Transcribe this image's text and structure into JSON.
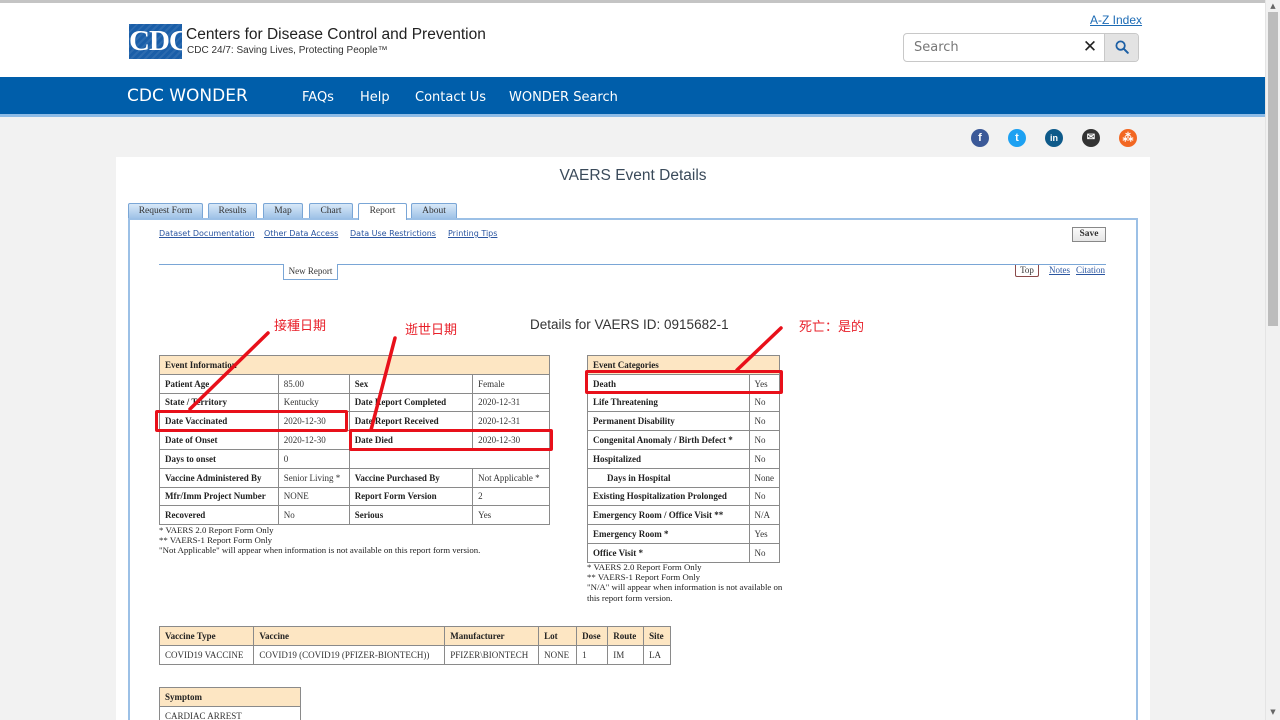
{
  "header": {
    "logo_text": "CDC",
    "org_name": "Centers for Disease Control and Prevention",
    "tagline": "CDC 24/7: Saving Lives, Protecting People™",
    "az_index": "A-Z Index",
    "search_placeholder": "Search",
    "search_value": "",
    "clear_glyph": "✕"
  },
  "nav": {
    "brand": "CDC WONDER",
    "items": [
      "FAQs",
      "Help",
      "Contact Us",
      "WONDER Search"
    ]
  },
  "social": [
    {
      "icon": "facebook-icon",
      "glyph": "f",
      "color": "#3b5998"
    },
    {
      "icon": "twitter-icon",
      "glyph": "t",
      "color": "#1da1f2"
    },
    {
      "icon": "linkedin-icon",
      "glyph": "in",
      "color": "#0e5a8a"
    },
    {
      "icon": "email-icon",
      "glyph": "✉",
      "color": "#333333"
    },
    {
      "icon": "syndicate-icon",
      "glyph": "⁂",
      "color": "#f26722"
    }
  ],
  "page": {
    "title": "VAERS Event Details",
    "tabs": [
      "Request Form",
      "Results",
      "Map",
      "Chart",
      "Report",
      "About"
    ],
    "active_tab": "Report",
    "links": [
      "Dataset Documentation",
      "Other Data Access",
      "Data Use Restrictions",
      "Printing Tips"
    ],
    "save_label": "Save",
    "new_report_label": "New Report",
    "top_label": "Top",
    "notes_label": "Notes",
    "citation_label": "Citation",
    "details_title": "Details for VAERS ID: 0915682-1"
  },
  "annotations": {
    "date_vaccinated": "接種日期",
    "date_died": "逝世日期",
    "death_yes": "死亡：是的",
    "highlight_color": "#e8101a"
  },
  "event_information": {
    "header": "Event Information",
    "rows": [
      [
        {
          "label": "Patient Age",
          "value": "85.00"
        },
        {
          "label": "Sex",
          "value": "Female"
        }
      ],
      [
        {
          "label": "State / Territory",
          "value": "Kentucky"
        },
        {
          "label": "Date Report Completed",
          "value": "2020-12-31"
        }
      ],
      [
        {
          "label": "Date Vaccinated",
          "value": "2020-12-30"
        },
        {
          "label": "Date Report Received",
          "value": "2020-12-31"
        }
      ],
      [
        {
          "label": "Date of Onset",
          "value": "2020-12-30"
        },
        {
          "label": "Date Died",
          "value": "2020-12-30"
        }
      ],
      [
        {
          "label": "Days to onset",
          "value": "0"
        },
        {
          "label": "",
          "value": ""
        }
      ],
      [
        {
          "label": "Vaccine Administered By",
          "value": "Senior Living *"
        },
        {
          "label": "Vaccine Purchased By",
          "value": "Not Applicable *"
        }
      ],
      [
        {
          "label": "Mfr/Imm Project Number",
          "value": "NONE"
        },
        {
          "label": "Report Form Version",
          "value": "2"
        }
      ],
      [
        {
          "label": "Recovered",
          "value": "No"
        },
        {
          "label": "Serious",
          "value": "Yes"
        }
      ]
    ],
    "notes": [
      "* VAERS 2.0 Report Form Only",
      "** VAERS-1 Report Form Only",
      "\"Not Applicable\" will appear when information is not available on this report form version."
    ]
  },
  "event_categories": {
    "header": "Event Categories",
    "rows": [
      {
        "label": "Death",
        "value": "Yes"
      },
      {
        "label": "Life Threatening",
        "value": "No"
      },
      {
        "label": "Permanent Disability",
        "value": "No"
      },
      {
        "label": "Congenital Anomaly / Birth Defect *",
        "value": "No"
      },
      {
        "label": "Hospitalized",
        "value": "No"
      },
      {
        "label": "Days in Hospital",
        "value": "None",
        "indent": true
      },
      {
        "label": "Existing Hospitalization Prolonged",
        "value": "No"
      },
      {
        "label": "Emergency Room / Office Visit **",
        "value": "N/A"
      },
      {
        "label": "Emergency Room *",
        "value": "Yes"
      },
      {
        "label": "Office Visit *",
        "value": "No"
      }
    ],
    "notes": [
      "* VAERS 2.0 Report Form Only",
      "** VAERS-1 Report Form Only",
      "\"N/A\" will appear when information is not available on",
      "this report form version."
    ]
  },
  "vaccine_table": {
    "columns": [
      "Vaccine Type",
      "Vaccine",
      "Manufacturer",
      "Lot",
      "Dose",
      "Route",
      "Site"
    ],
    "rows": [
      [
        "COVID19 VACCINE",
        "COVID19 (COVID19 (PFIZER-BIONTECH))",
        "PFIZER\\BIONTECH",
        "NONE",
        "1",
        "IM",
        "LA"
      ]
    ]
  },
  "symptom_table": {
    "header": "Symptom",
    "rows": [
      "CARDIAC ARREST"
    ]
  }
}
